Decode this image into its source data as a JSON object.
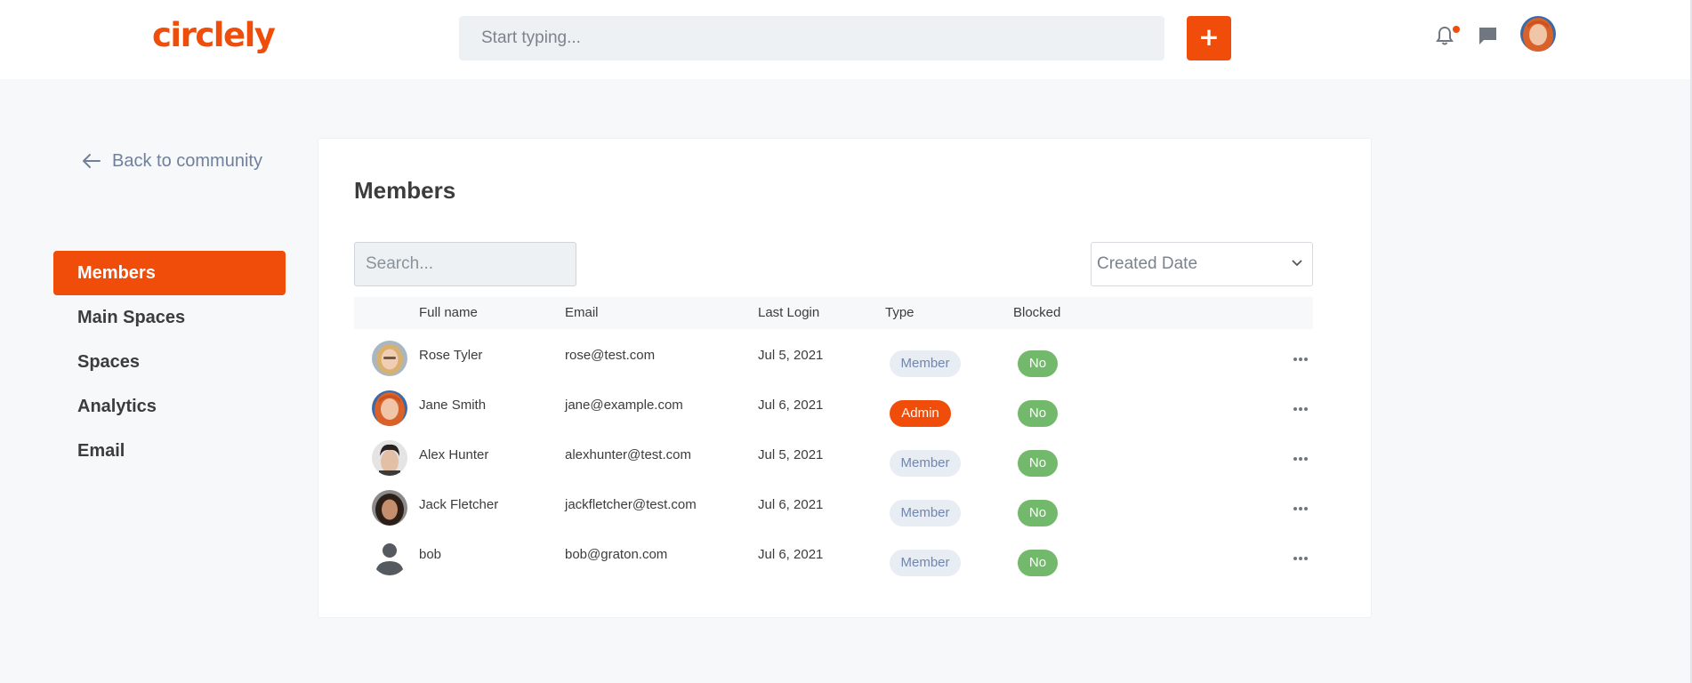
{
  "header": {
    "logo": "circlely",
    "search_placeholder": "Start typing...",
    "add_label": "+"
  },
  "sidebar": {
    "back_label": "Back to community",
    "items": [
      {
        "label": "Members",
        "active": true
      },
      {
        "label": "Main Spaces",
        "active": false
      },
      {
        "label": "Spaces",
        "active": false
      },
      {
        "label": "Analytics",
        "active": false
      },
      {
        "label": "Email",
        "active": false
      }
    ]
  },
  "main": {
    "title": "Members",
    "search_placeholder": "Search...",
    "sort_selected": "Created Date",
    "columns": [
      "Full name",
      "Email",
      "Last Login",
      "Type",
      "Blocked"
    ],
    "rows": [
      {
        "name": "Rose Tyler",
        "email": "rose@test.com",
        "last_login": "Jul 5, 2021",
        "type": "Member",
        "blocked": "No",
        "avatar": "rose-photo"
      },
      {
        "name": "Jane Smith",
        "email": "jane@example.com",
        "last_login": "Jul 6, 2021",
        "type": "Admin",
        "blocked": "No",
        "avatar": "jane-photo"
      },
      {
        "name": "Alex Hunter",
        "email": "alexhunter@test.com",
        "last_login": "Jul 5, 2021",
        "type": "Member",
        "blocked": "No",
        "avatar": "alex-photo"
      },
      {
        "name": "Jack Fletcher",
        "email": "jackfletcher@test.com",
        "last_login": "Jul 6, 2021",
        "type": "Member",
        "blocked": "No",
        "avatar": "jack-photo"
      },
      {
        "name": "bob",
        "email": "bob@graton.com",
        "last_login": "Jul 6, 2021",
        "type": "Member",
        "blocked": "No",
        "avatar": "default-user-icon"
      }
    ]
  },
  "colors": {
    "brand": "#f04d0b",
    "member_pill": "#e8ecf3",
    "blocked_no": "#73b96b"
  }
}
